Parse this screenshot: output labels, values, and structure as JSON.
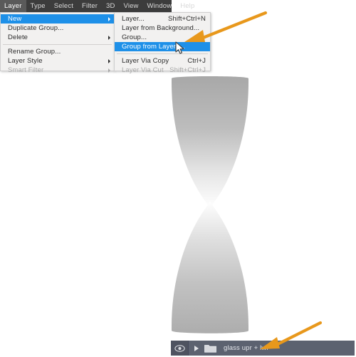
{
  "app": {
    "accent_highlight": "#1e90e8",
    "menubar_bg": "#3c3c3c",
    "menu_bg": "#f2f1f0",
    "annotation_color": "#e8981c",
    "panel_bg": "#5c6270"
  },
  "menubar": {
    "items": [
      {
        "label": "Layer",
        "active": true
      },
      {
        "label": "Type",
        "active": false
      },
      {
        "label": "Select",
        "active": false
      },
      {
        "label": "Filter",
        "active": false
      },
      {
        "label": "3D",
        "active": false
      },
      {
        "label": "View",
        "active": false
      },
      {
        "label": "Window",
        "active": false
      },
      {
        "label": "Help",
        "active": false
      }
    ]
  },
  "layer_menu": {
    "items": [
      {
        "label": "New",
        "accel": "",
        "selected": true,
        "submenu": true,
        "disabled": false
      },
      {
        "label": "Duplicate Group...",
        "accel": "",
        "selected": false,
        "submenu": false,
        "disabled": false
      },
      {
        "label": "Delete",
        "accel": "",
        "selected": false,
        "submenu": true,
        "disabled": false
      },
      {
        "label": "Rename Group...",
        "accel": "",
        "selected": false,
        "submenu": false,
        "disabled": false
      },
      {
        "label": "Layer Style",
        "accel": "",
        "selected": false,
        "submenu": true,
        "disabled": false
      },
      {
        "label": "Smart Filter",
        "accel": "",
        "selected": false,
        "submenu": true,
        "disabled": true
      }
    ]
  },
  "new_submenu": {
    "items": [
      {
        "label": "Layer...",
        "accel": "Shift+Ctrl+N",
        "selected": false,
        "submenu": false,
        "disabled": false
      },
      {
        "label": "Layer from Background...",
        "accel": "",
        "selected": false,
        "submenu": false,
        "disabled": false
      },
      {
        "label": "Group...",
        "accel": "",
        "selected": false,
        "submenu": false,
        "disabled": false
      },
      {
        "label": "Group from Layers...",
        "accel": "",
        "selected": true,
        "submenu": false,
        "disabled": false
      },
      {
        "label": "Layer Via Copy",
        "accel": "Ctrl+J",
        "selected": false,
        "submenu": false,
        "disabled": false
      },
      {
        "label": "Layer Via Cut",
        "accel": "Shift+Ctrl+J",
        "selected": false,
        "submenu": false,
        "disabled": true
      }
    ]
  },
  "layers_panel": {
    "visibility_icon": "eye-icon",
    "disclosure_icon": "triangle-right-icon",
    "group_icon": "folder-icon",
    "layer_name": "glass upr + lwr"
  },
  "artwork": {
    "name": "hourglass-shape",
    "description": "Hourglass silhouette with vertical gray-to-white gradient"
  },
  "annotations": [
    {
      "name": "arrow-to-group-from-layers",
      "color": "#e8981c"
    },
    {
      "name": "arrow-to-layer-name",
      "color": "#e8981c"
    }
  ],
  "cursor": {
    "name": "mouse-pointer"
  }
}
